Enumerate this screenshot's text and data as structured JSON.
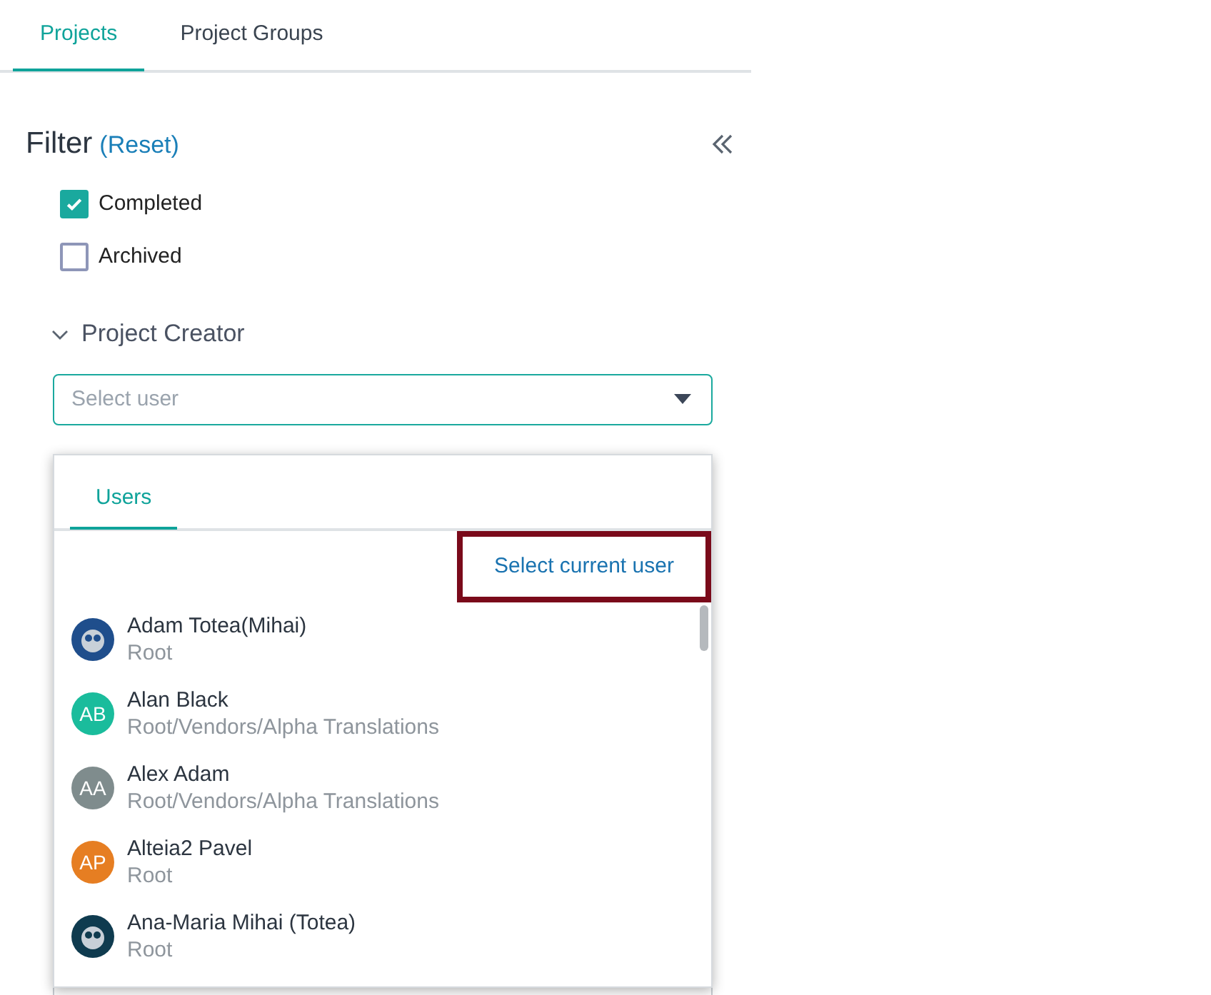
{
  "tabs": [
    {
      "label": "Projects",
      "selected": true
    },
    {
      "label": "Project Groups",
      "selected": false
    }
  ],
  "filter": {
    "title": "Filter",
    "reset": "(Reset)",
    "statuses": [
      {
        "label": "Completed",
        "checked": true
      },
      {
        "label": "Archived",
        "checked": false
      }
    ],
    "creator": {
      "label": "Project Creator",
      "expanded": true,
      "placeholder": "Select user"
    }
  },
  "dropdown": {
    "tabs": [
      {
        "label": "Users",
        "selected": true
      }
    ],
    "select_current": "Select current user",
    "users": [
      {
        "name": "Adam Totea(Mihai)",
        "path": "Root"
      },
      {
        "name": "Alan Black",
        "path": "Root/Vendors/Alpha Translations",
        "avatar": {
          "kind": "initials",
          "initials": "AB",
          "color": "#1abc9c"
        }
      },
      {
        "name": "Alex Adam",
        "path": "Root/Vendors/Alpha Translations",
        "avatar": {
          "kind": "initials",
          "initials": "AA",
          "color": "#7f8c8d"
        }
      },
      {
        "name": "Alteia2 Pavel",
        "path": "Root",
        "avatar": {
          "kind": "initials",
          "initials": "AP",
          "color": "#e67e22"
        }
      },
      {
        "name": "Ana-Maria Mihai (Totea)",
        "path": "Root"
      }
    ]
  }
}
